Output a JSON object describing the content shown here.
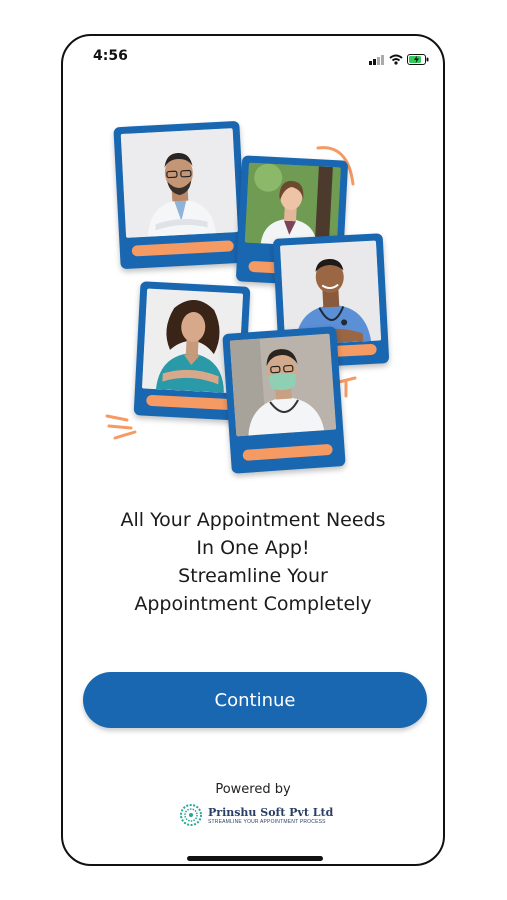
{
  "status_bar": {
    "time": "4:56",
    "icons": [
      "signal-icon",
      "wifi-icon",
      "battery-charging-icon"
    ]
  },
  "illustration": {
    "cards": [
      {
        "name": "doctor-card-1",
        "subject": "doctor-in-white-coat-arms-crossed"
      },
      {
        "name": "doctor-card-2",
        "subject": "female-doctor-outdoors"
      },
      {
        "name": "doctor-card-3",
        "subject": "doctor-in-scrubs-with-stethoscope"
      },
      {
        "name": "doctor-card-4",
        "subject": "female-doctor-in-teal-scrubs"
      },
      {
        "name": "doctor-card-5",
        "subject": "doctor-with-face-mask"
      }
    ]
  },
  "headline": {
    "line1": "All Your Appointment Needs",
    "line2": "In One App!",
    "line3": "Streamline Your",
    "line4": "Appointment Completely"
  },
  "continue_button": {
    "label": "Continue"
  },
  "footer": {
    "powered_by": "Powered by",
    "company_name": "Prinshu Soft Pvt Ltd",
    "company_tagline": "STREAMLINE YOUR APPOINTMENT PROCESS"
  },
  "colors": {
    "primary": "#1a67b1",
    "accent": "#f59a63",
    "text": "#1b1b1b"
  }
}
